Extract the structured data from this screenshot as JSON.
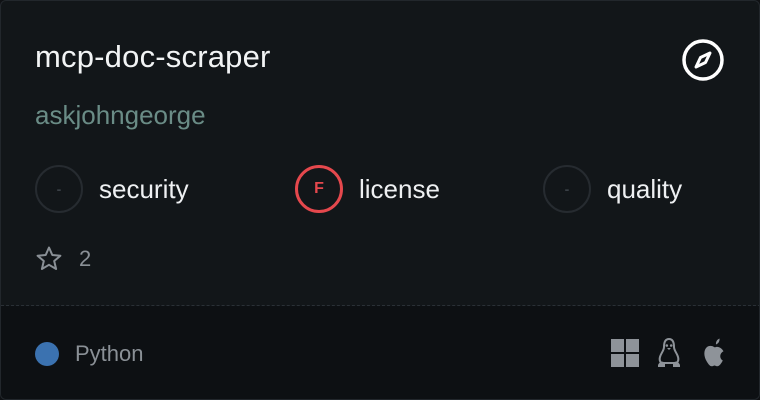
{
  "repo": {
    "name": "mcp-doc-scraper",
    "owner": "askjohngeorge"
  },
  "metrics": [
    {
      "grade": "-",
      "label": "security",
      "status": "none"
    },
    {
      "grade": "F",
      "label": "license",
      "status": "fail"
    },
    {
      "grade": "-",
      "label": "quality",
      "status": "none"
    }
  ],
  "stars": {
    "count": "2",
    "icon": "star-icon"
  },
  "language": {
    "name": "Python",
    "color": "#3b72b0"
  },
  "platforms": [
    "windows-icon",
    "linux-icon",
    "apple-icon"
  ],
  "colors": {
    "accent_fail": "#e5484d",
    "owner": "#6a8c86"
  },
  "header_icon": "compass-icon"
}
